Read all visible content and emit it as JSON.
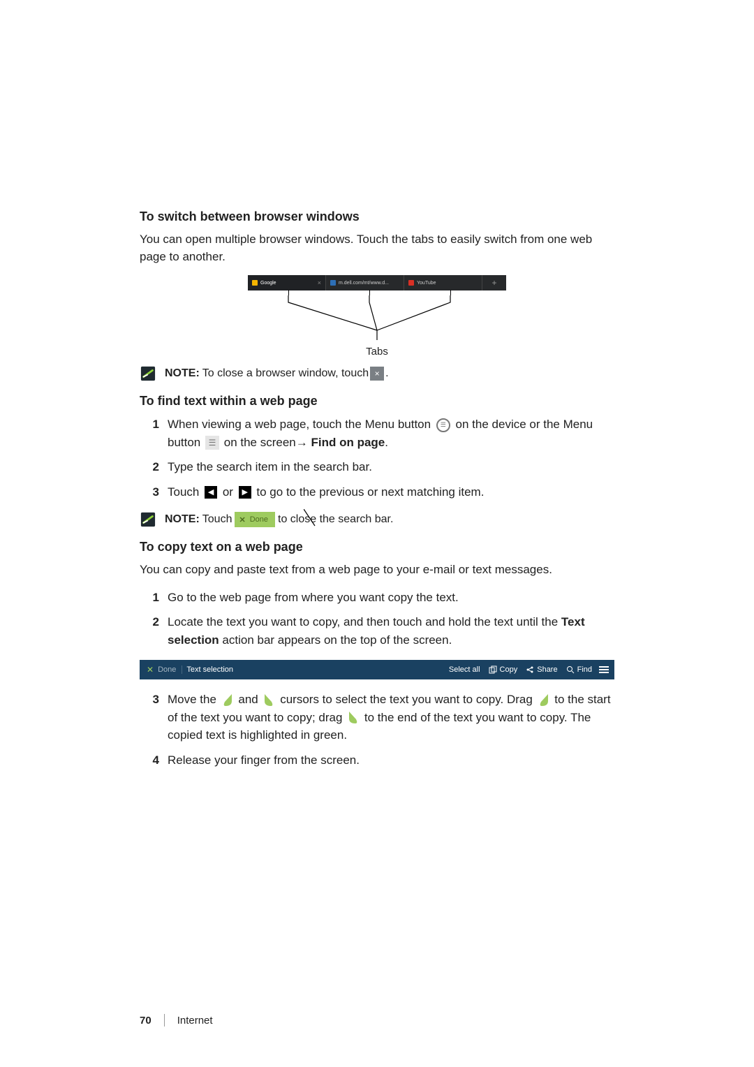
{
  "section_switch": {
    "heading": "To switch between browser windows",
    "body": "You can open multiple browser windows. Touch the tabs to easily switch from one web page to another.",
    "tabs_caption": "Tabs",
    "tabs": {
      "tab1_label": "Google",
      "tab2_label": "m.dell.com/mt/www.d...",
      "tab3_label": "YouTube",
      "new_tab": "+"
    },
    "note_label": "NOTE:",
    "note_text_a": "To close a browser window, touch",
    "note_text_b": ".",
    "close_glyph": "×"
  },
  "section_find": {
    "heading": "To find text within a web page",
    "step1_a": "When viewing a web page, touch the Menu button ",
    "step1_b": " on the device or the Menu button ",
    "step1_c": " on the screen→ ",
    "step1_d": "Find on page",
    "step1_e": ".",
    "menu_circle_glyph": "☰",
    "menu_box_glyph": "☰",
    "step2": "Type the search item in the search bar.",
    "step3_a": "Touch ",
    "step3_b": " or ",
    "step3_c": " to go to the previous or next matching item.",
    "prev_glyph": "◀",
    "next_glyph": "▶",
    "note_label": "NOTE:",
    "note_text_a": "Touch",
    "note_text_b": "to close the search bar.",
    "done_pill_x": "✕",
    "done_pill_text": "Done"
  },
  "section_copy": {
    "heading": "To copy text on a web page",
    "body": "You can copy and paste text from a web page to your e-mail or text messages.",
    "step1": "Go to the web page from where you want copy the text.",
    "step2_a": "Locate the text you want to copy, and then touch and hold the text until the ",
    "step2_b": "Text selection",
    "step2_c": " action bar appears on the top of the screen.",
    "bar": {
      "done_x": "✕",
      "done": "Done",
      "title": "Text selection",
      "select_all": "Select all",
      "copy": "Copy",
      "share": "Share",
      "find": "Find"
    },
    "step3_a": "Move the ",
    "step3_b": " and ",
    "step3_c": " cursors to select the text you want to copy. Drag ",
    "step3_d": " to the start of the text you want to copy; drag ",
    "step3_e": " to the end of the text you want to copy. The copied text is highlighted in green.",
    "step4": "Release your finger from the screen."
  },
  "footer": {
    "page_number": "70",
    "section": "Internet"
  },
  "step_numbers": {
    "n1": "1",
    "n2": "2",
    "n3": "3",
    "n4": "4"
  }
}
